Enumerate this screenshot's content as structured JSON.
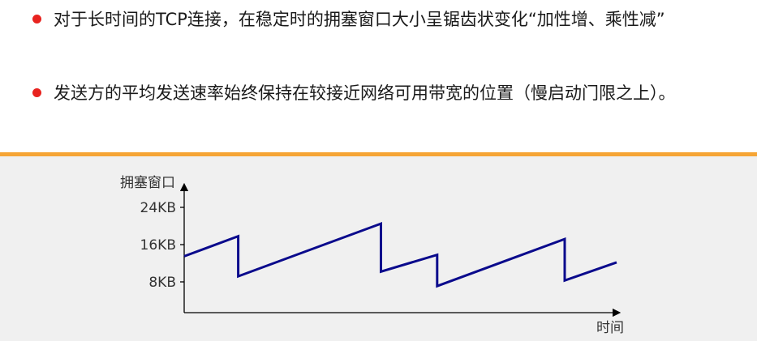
{
  "bullets": [
    {
      "text": "对于长时间的TCP连接，在稳定时的拥塞窗口大小呈锯齿状变化“加性增、乘性减”"
    },
    {
      "text": "发送方的平均发送速率始终保持在较接近网络可用带宽的位置（慢启动门限之上）。"
    }
  ],
  "colors": {
    "bullet_dot": "#e8231f",
    "divider": "#f6a535",
    "chart_background": "#f0f0f0",
    "line": "#0a0a8c"
  },
  "chart_data": {
    "type": "line",
    "ylabel": "拥塞窗口",
    "xlabel": "时间",
    "y_ticks": [
      {
        "value": 24,
        "label": "24KB"
      },
      {
        "value": 16,
        "label": "16KB"
      },
      {
        "value": 8,
        "label": "8KB"
      }
    ],
    "ylim": [
      0,
      28
    ],
    "xlim": [
      0,
      100
    ],
    "series": [
      {
        "points": [
          {
            "x": 0,
            "y": 13.5
          },
          {
            "x": 12.5,
            "y": 17.8
          },
          {
            "x": 12.5,
            "y": 9.2
          },
          {
            "x": 45.5,
            "y": 20.5
          },
          {
            "x": 45.5,
            "y": 10.2
          },
          {
            "x": 58.5,
            "y": 13.8
          },
          {
            "x": 58.5,
            "y": 7.1
          },
          {
            "x": 88,
            "y": 17.2
          },
          {
            "x": 88,
            "y": 8.3
          },
          {
            "x": 100,
            "y": 12.2
          }
        ]
      }
    ]
  }
}
